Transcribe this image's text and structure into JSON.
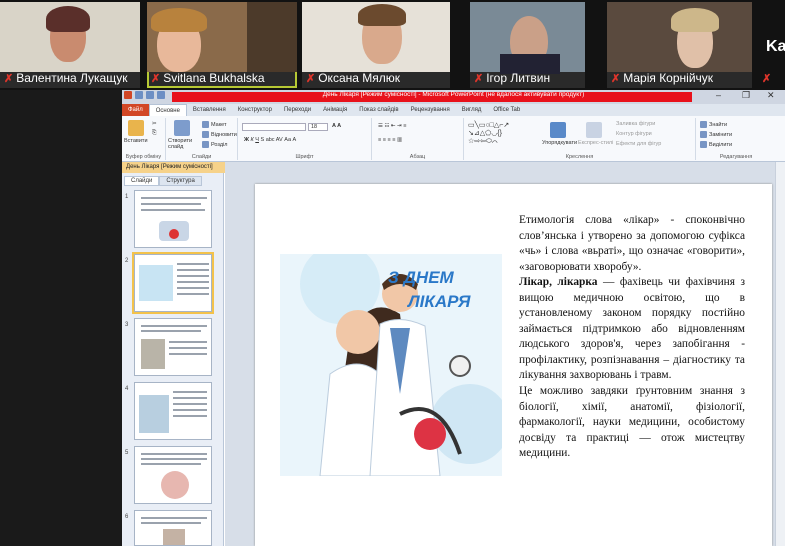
{
  "participants": [
    {
      "name": "Валентина Лукащук",
      "muted": true
    },
    {
      "name": "Svitlana Bukhalska",
      "muted": true
    },
    {
      "name": "Оксана Мялюк",
      "muted": true
    },
    {
      "name": "Ігор Литвин",
      "muted": true
    },
    {
      "name": "Марія Корнійчук",
      "muted": true
    },
    {
      "name": "Ka",
      "muted": true
    }
  ],
  "ppt": {
    "window_title": "День Лікаря [Режим сумісності] - Microsoft PowerPoint (не вдалося активувати продукт)",
    "tabs": [
      "Файл",
      "Основне",
      "Вставлення",
      "Конструктор",
      "Переходи",
      "Анімація",
      "Показ слайдів",
      "Рецензування",
      "Вигляд",
      "Office Tab"
    ],
    "active_tab": "Основне",
    "ribbon": {
      "paste": "Вставити",
      "clipboard": "Буфер обміну",
      "new_slide": "Створити слайд",
      "layout": "Макет",
      "reset": "Відновити",
      "section": "Розділ",
      "slides_group": "Слайди",
      "font_size": "18",
      "font_group": "Шрифт",
      "paragraph_group": "Абзац",
      "arrange": "Упорядкувати",
      "quick_styles": "Експрес-стилі",
      "drawing_group": "Креслення",
      "shape_fill": "Заливка фігури",
      "shape_outline": "Контур фігури",
      "shape_effects": "Ефекти для фігур",
      "find": "Знайти",
      "replace": "Замінити",
      "select": "Виділити",
      "editing_group": "Редагування"
    },
    "doc_tab": "День Лікаря [Режим сумісності]",
    "panel_tabs": [
      "Слайди",
      "Структура"
    ],
    "slide_numbers": [
      "1",
      "2",
      "3",
      "4",
      "5",
      "6"
    ],
    "selected_slide": 2,
    "slide": {
      "banner_line1": "З ДНЕМ",
      "banner_line2": "ЛІКАРЯ",
      "para1": "Етимологія слова «лікар» - споконвічно слов’янська і утворено за допомогою суфікса «чь» і слова «вьраті», що означає «говорити», «заговорювати хворобу».",
      "para2_bold": "Лікар, лікарка",
      "para2": " — фахівець чи фахівчиня з вищою медичною освітою, що в установленому законом порядку постійно займається підтримкою або відновленням людського здоров'я, через запобігання - профілактику, розпізнавання – діагностику та лікування захворювань і травм.",
      "para3": "Це можливо завдяки ґрунтовним знання з біології, хімії, анатомії, фізіології, фармакології, науки медицини, особистому досвіду та практиці — отож мистецтву медицини."
    }
  }
}
